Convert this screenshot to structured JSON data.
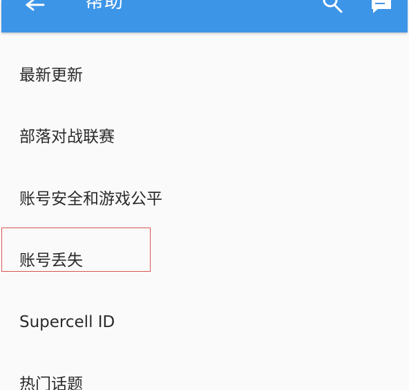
{
  "appbar": {
    "title": "帮助",
    "background_color": "#3d95e8",
    "back_icon": "arrow-left-icon",
    "search_icon": "search-icon",
    "chat_icon": "chat-bubble-icon"
  },
  "list": {
    "items": [
      {
        "label": "最新更新"
      },
      {
        "label": "部落对战联赛"
      },
      {
        "label": "账号安全和游戏公平"
      },
      {
        "label": "账号丢失"
      },
      {
        "label": "Supercell ID"
      },
      {
        "label": "热门话题"
      }
    ]
  },
  "highlight": {
    "target": "账号丢失",
    "color": "#d9534f"
  }
}
